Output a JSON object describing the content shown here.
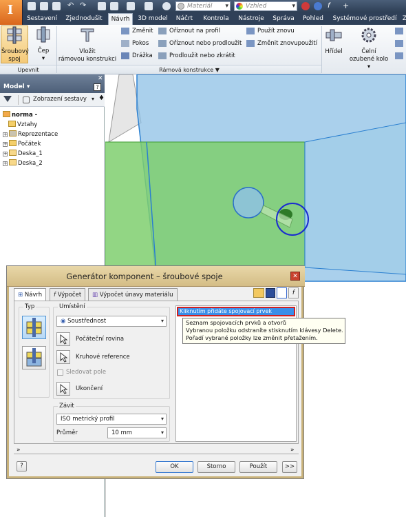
{
  "quick_access": {
    "material_placeholder": "Materiál",
    "appearance_placeholder": "Vzhled"
  },
  "tabs": [
    "Sestavení",
    "Zjednodušit",
    "Návrh",
    "3D model",
    "Náčrt",
    "Kontrola",
    "Nástroje",
    "Správa",
    "Pohled",
    "Systémové prostředí",
    "Z"
  ],
  "ribbon": {
    "fasten_group": {
      "bolted_label_1": "Šroubový",
      "bolted_label_2": "spoj",
      "pin_label": "Čep",
      "group": "Upevnit"
    },
    "frame_group": {
      "insert_frame_1": "Vložit",
      "insert_frame_2": "rámovou konstrukci",
      "change": "Změnit",
      "notch": "Pokos",
      "groove": "Drážka",
      "trim_profile": "Oříznout na profil",
      "trim_extend": "Oříznout nebo prodloužit",
      "lengthen": "Prodloužit nebo zkrátit",
      "reuse": "Použít znovu",
      "change_reuse": "Změnit znovupoužití",
      "group": "Rámová konstrukce ▼"
    },
    "power_group": {
      "shaft": "Hřídel",
      "spur_1": "Čelní",
      "spur_2": "ozubené kolo ▾"
    }
  },
  "browser": {
    "title": "Model ▾",
    "view_label": "Zobrazení sestavy",
    "tree": [
      {
        "label": "norma -",
        "bold": true
      },
      {
        "label": "Vztahy"
      },
      {
        "label": "Reprezentace"
      },
      {
        "label": "Počátek"
      },
      {
        "label": "Deska_1"
      },
      {
        "label": "Deska_2"
      }
    ]
  },
  "dialog": {
    "title": "Generátor komponent – šroubové spoje",
    "tabs": [
      "Návrh",
      "Výpočet",
      "Výpočet únavy materiálu"
    ],
    "type_label": "Typ",
    "placement_label": "Umístění",
    "placement_value": "Soustřednost",
    "start_plane": "Počáteční rovina",
    "circular_ref": "Kruhové reference",
    "follow_pattern": "Sledovat pole",
    "termination": "Ukončení",
    "thread_label": "Závit",
    "thread_value": "ISO metrický profil",
    "diameter_label": "Průměr",
    "diameter_value": "10 mm",
    "click_to_add": "Kliknutím přidáte spojovací prvek",
    "tooltip": [
      "Seznam spojovacích prvků a otvorů",
      "Vybranou položku odstraníte stisknutím klávesy Delete.",
      "Pořadí vybrané položky lze změnit přetažením."
    ],
    "ok": "OK",
    "cancel": "Storno",
    "apply": "Použít",
    "more": ">>",
    "help": "?"
  }
}
